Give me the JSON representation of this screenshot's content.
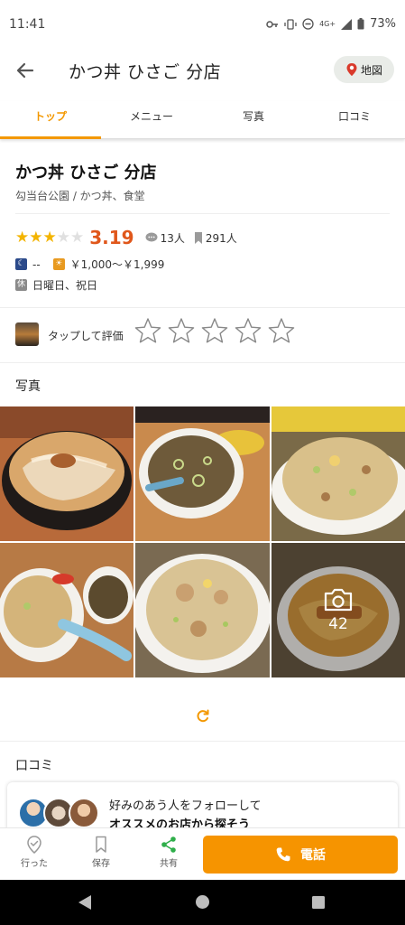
{
  "status_bar": {
    "time": "11:41",
    "network": "4G+",
    "battery": "73%"
  },
  "app_bar": {
    "title": "かつ丼 ひさご 分店",
    "map_label": "地図"
  },
  "tabs": [
    {
      "label": "トップ",
      "active": true
    },
    {
      "label": "メニュー",
      "active": false
    },
    {
      "label": "写真",
      "active": false
    },
    {
      "label": "口コミ",
      "active": false
    }
  ],
  "shop": {
    "name": "かつ丼 ひさご 分店",
    "area_genre": "勾当台公園 / かつ丼、食堂",
    "rating_stars": 3,
    "rating_score": "3.19",
    "review_count": "13人",
    "bookmark_count": "291人",
    "dinner_budget": "--",
    "lunch_budget": "￥1,000～￥1,999",
    "closed": "日曜日、祝日"
  },
  "rate_prompt": "タップして評価",
  "photos": {
    "heading": "写真",
    "more_count": "42"
  },
  "reviews": {
    "heading": "口コミ",
    "follow_line1": "好みのあう人をフォローして",
    "follow_line2": "オススメのお店から探そう"
  },
  "bottom_bar": {
    "went_label": "行った",
    "save_label": "保存",
    "share_label": "共有",
    "call_label": "電話"
  },
  "colors": {
    "accent": "#f39800",
    "score": "#e0571b",
    "star": "#f3b400",
    "call": "#f69400"
  }
}
